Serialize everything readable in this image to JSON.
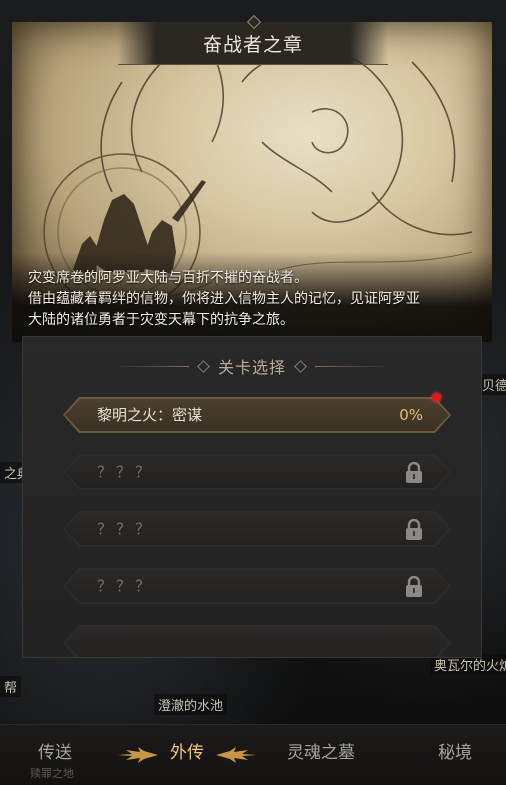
{
  "background": {
    "labels": [
      "贝德",
      "之典",
      "澄澈的水池",
      "奥瓦尔的火炉",
      "帮"
    ]
  },
  "header": {
    "title": "奋战者之章"
  },
  "description": {
    "line1": "灾变席卷的阿罗亚大陆与百折不摧的奋战者。",
    "line2": "借由蕴藏着羁绊的信物，你将进入信物主人的记忆，见证阿罗亚",
    "line3": "大陆的诸位勇者于灾变天幕下的抗争之旅。"
  },
  "stage_panel": {
    "title": "关卡选择",
    "stages": [
      {
        "name": "黎明之火：密谋",
        "progress": "0%",
        "locked": false,
        "has_notification": true
      },
      {
        "name": "？？？",
        "locked": true
      },
      {
        "name": "？？？",
        "locked": true
      },
      {
        "name": "？？？",
        "locked": true
      }
    ]
  },
  "tabbar": {
    "tabs": [
      {
        "label": "传送",
        "active": false
      },
      {
        "label": "外传",
        "active": true
      },
      {
        "label": "灵魂之墓",
        "active": false
      },
      {
        "label": "秘境",
        "active": false
      }
    ],
    "under_label": "赎罪之地"
  },
  "colors": {
    "accent_gold": "#f2c67a",
    "progress_gold": "#e2c073",
    "notification_red": "#e01b1b"
  }
}
